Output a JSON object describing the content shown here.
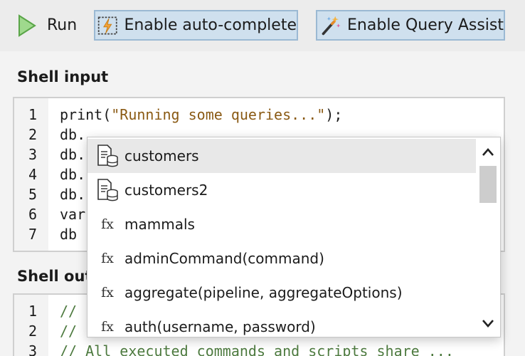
{
  "toolbar": {
    "run_label": "Run",
    "autocomplete_label": "Enable auto-complete",
    "query_assist_label": "Enable Query Assist"
  },
  "shell_input": {
    "title": "Shell input",
    "lines": [
      {
        "num": "1",
        "pre": "print(",
        "str": "\"Running some queries...\"",
        "post": ");"
      },
      {
        "num": "2",
        "pre": "db.",
        "str": "",
        "post": ""
      },
      {
        "num": "3",
        "pre": "db.",
        "str": "",
        "post": ""
      },
      {
        "num": "4",
        "pre": "db.",
        "str": "",
        "post": ""
      },
      {
        "num": "5",
        "pre": "db.",
        "str": "",
        "post": ""
      },
      {
        "num": "6",
        "pre": "var",
        "str": "",
        "post": ""
      },
      {
        "num": "7",
        "pre": "db",
        "str": "",
        "post": ""
      }
    ]
  },
  "autocomplete": {
    "items": [
      {
        "icon": "collection-icon",
        "label": "customers",
        "selected": true
      },
      {
        "icon": "collection-icon",
        "label": "customers2",
        "selected": false
      },
      {
        "icon": "function-icon",
        "glyph": "fx",
        "label": "mammals",
        "selected": false
      },
      {
        "icon": "function-icon",
        "glyph": "fx",
        "label": "adminCommand(command)",
        "selected": false
      },
      {
        "icon": "function-icon",
        "glyph": "fx",
        "label": "aggregate(pipeline, aggregateOptions)",
        "selected": false
      },
      {
        "icon": "function-icon",
        "glyph": "fx",
        "label": "auth(username, password)",
        "selected": false
      }
    ]
  },
  "shell_output": {
    "title": "Shell out",
    "lines": [
      {
        "num": "1",
        "text": "//"
      },
      {
        "num": "2",
        "text": "//"
      },
      {
        "num": "3",
        "text": "// All executed commands and scripts share ..."
      }
    ]
  },
  "colors": {
    "toggle_bg": "#cfe0ee",
    "toggle_border": "#9bb9d3",
    "string": "#8a5a14",
    "comment": "#4d7a3f",
    "run_icon": "#7cc46a"
  }
}
